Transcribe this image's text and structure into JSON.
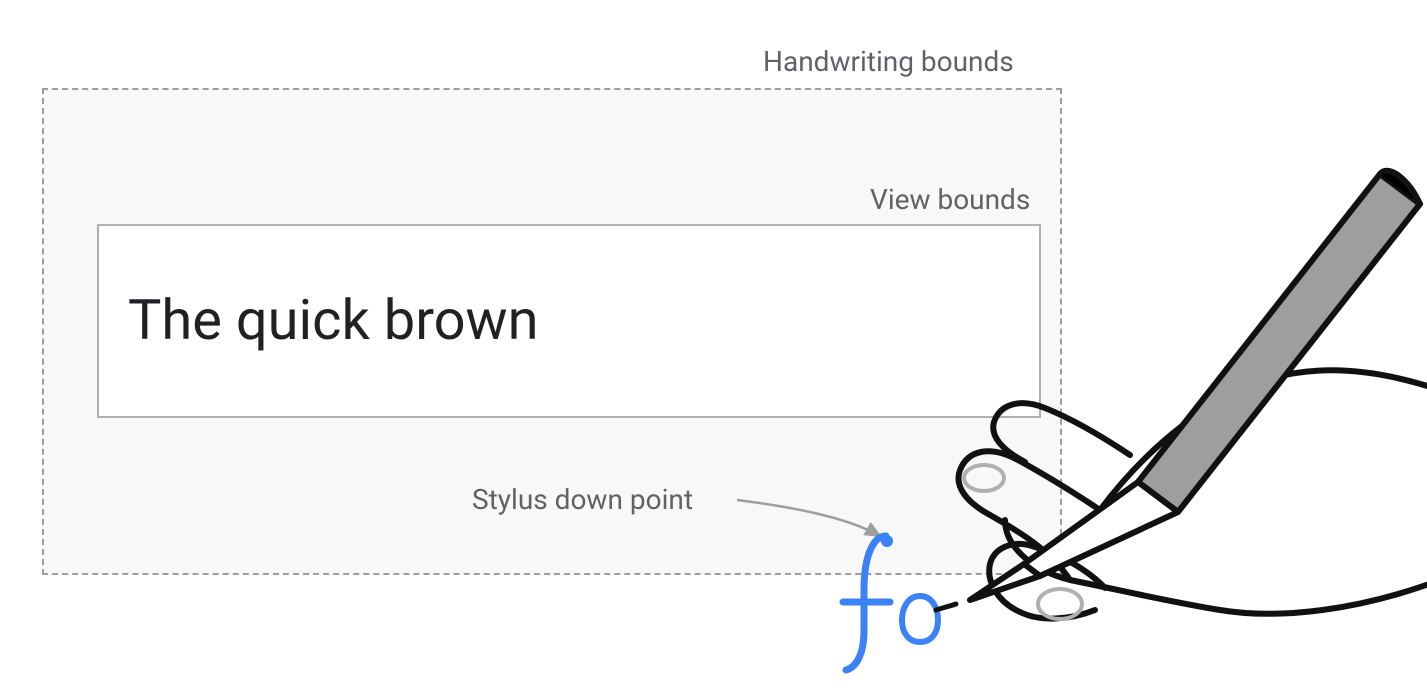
{
  "labels": {
    "handwriting_bounds": "Handwriting bounds",
    "view_bounds": "View bounds",
    "stylus_down_point": "Stylus down point"
  },
  "input": {
    "text": "The quick brown"
  },
  "ink": {
    "color": "#3b82f6",
    "text": "fo"
  },
  "stylus": {
    "pen_fill": "#9e9e9e"
  }
}
